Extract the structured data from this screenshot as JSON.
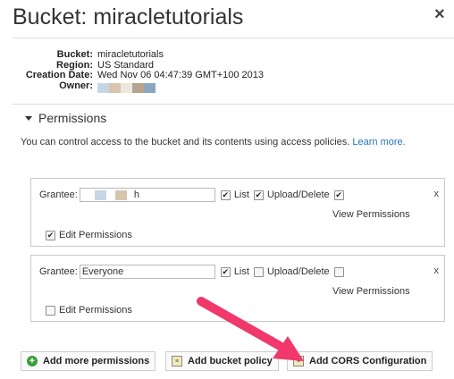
{
  "header": {
    "title": "Bucket: miracletutorials",
    "close_label": "×"
  },
  "details": {
    "rows": [
      {
        "label": "Bucket:",
        "value": "miracletutorials"
      },
      {
        "label": "Region:",
        "value": "US Standard"
      },
      {
        "label": "Creation Date:",
        "value": "Wed Nov 06 04:47:39 GMT+100 2013"
      },
      {
        "label": "Owner:",
        "value": ""
      }
    ],
    "owner_redaction_colors": [
      "#c7d6e4",
      "#d9c4ad",
      "#ede6dc",
      "#b7a48f",
      "#8da6c0"
    ]
  },
  "permissions": {
    "heading": "Permissions",
    "intro": "You can control access to the bucket and its contents using access policies.",
    "learn_more": "Learn more.",
    "grantee_label": "Grantee:",
    "list_label": "List",
    "upload_label": "Upload/Delete",
    "view_label": "View Permissions",
    "edit_label": "Edit Permissions",
    "remove_label": "x",
    "grants": [
      {
        "grantee": "h",
        "list": true,
        "upload": true,
        "view": true,
        "edit": true
      },
      {
        "grantee": "Everyone",
        "list": true,
        "upload": false,
        "view": false,
        "edit": false
      }
    ],
    "grantee_redaction_colors": [
      "#c7d6e4",
      "#d9c4ad"
    ]
  },
  "footer": {
    "add_permissions": "Add more permissions",
    "add_policy": "Add bucket policy",
    "add_cors": "Add CORS Configuration",
    "plus_color": "#3a9e3a",
    "arrow_color": "#f0386b"
  }
}
